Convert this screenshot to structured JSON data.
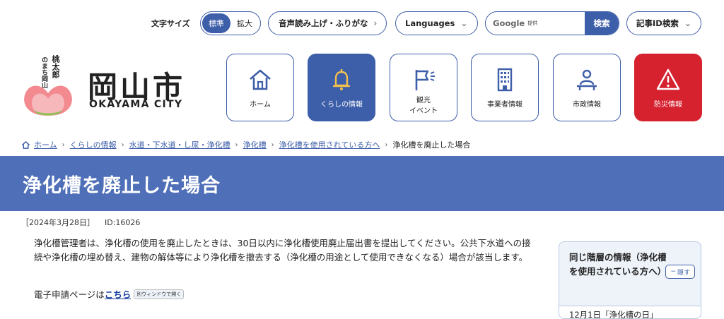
{
  "utility": {
    "font_size_label": "文字サイズ",
    "font_size_options": [
      "標準",
      "拡大"
    ],
    "read_aloud": "音声読み上げ・ふりがな",
    "languages": "Languages",
    "search_logo": "Google",
    "search_sub": "提供",
    "search_button": "検索",
    "article_id_search": "記事ID検索"
  },
  "logo": {
    "main": "岡山市",
    "english": "OKAYAMA CITY",
    "tagline_left": "のまち岡山",
    "tagline_right": "桃太郎"
  },
  "nav": [
    {
      "label": "ホーム",
      "icon": "home-icon"
    },
    {
      "label": "くらしの情報",
      "icon": "bell-icon"
    },
    {
      "label": "観光\nイベント",
      "icon": "flag-icon"
    },
    {
      "label": "事業者情報",
      "icon": "building-icon"
    },
    {
      "label": "市政情報",
      "icon": "person-desk-icon"
    },
    {
      "label": "防災情報",
      "icon": "warning-icon"
    }
  ],
  "breadcrumb": {
    "items": [
      "ホーム",
      "くらしの情報",
      "水道・下水道・し尿・浄化槽",
      "浄化槽",
      "浄化槽を使用されている方へ"
    ],
    "current": "浄化槽を廃止した場合"
  },
  "page": {
    "title": "浄化槽を廃止した場合",
    "date": "［2024年3月28日］",
    "id": "ID:16026",
    "body": "浄化槽管理者は、浄化槽の使用を廃止したときは、30日以内に浄化槽使用廃止届出書を提出してください。公共下水道への接続や浄化槽の埋め替え、建物の解体等により浄化槽を撤去する（浄化槽の用途として使用できなくなる）場合が該当します。",
    "e_apply_prefix": "電子申請ページは",
    "e_apply_link": "こちら",
    "new_window_badge": "別ウィンドウで開く"
  },
  "side": {
    "title": "同じ階層の情報（浄化槽を使用されている方へ）",
    "hide_button": "隠す",
    "first_item": "12月1日「浄化槽の日」"
  },
  "colors": {
    "primary": "#3d5ea9",
    "banner": "#4f6fb8",
    "disaster": "#d6212f"
  }
}
